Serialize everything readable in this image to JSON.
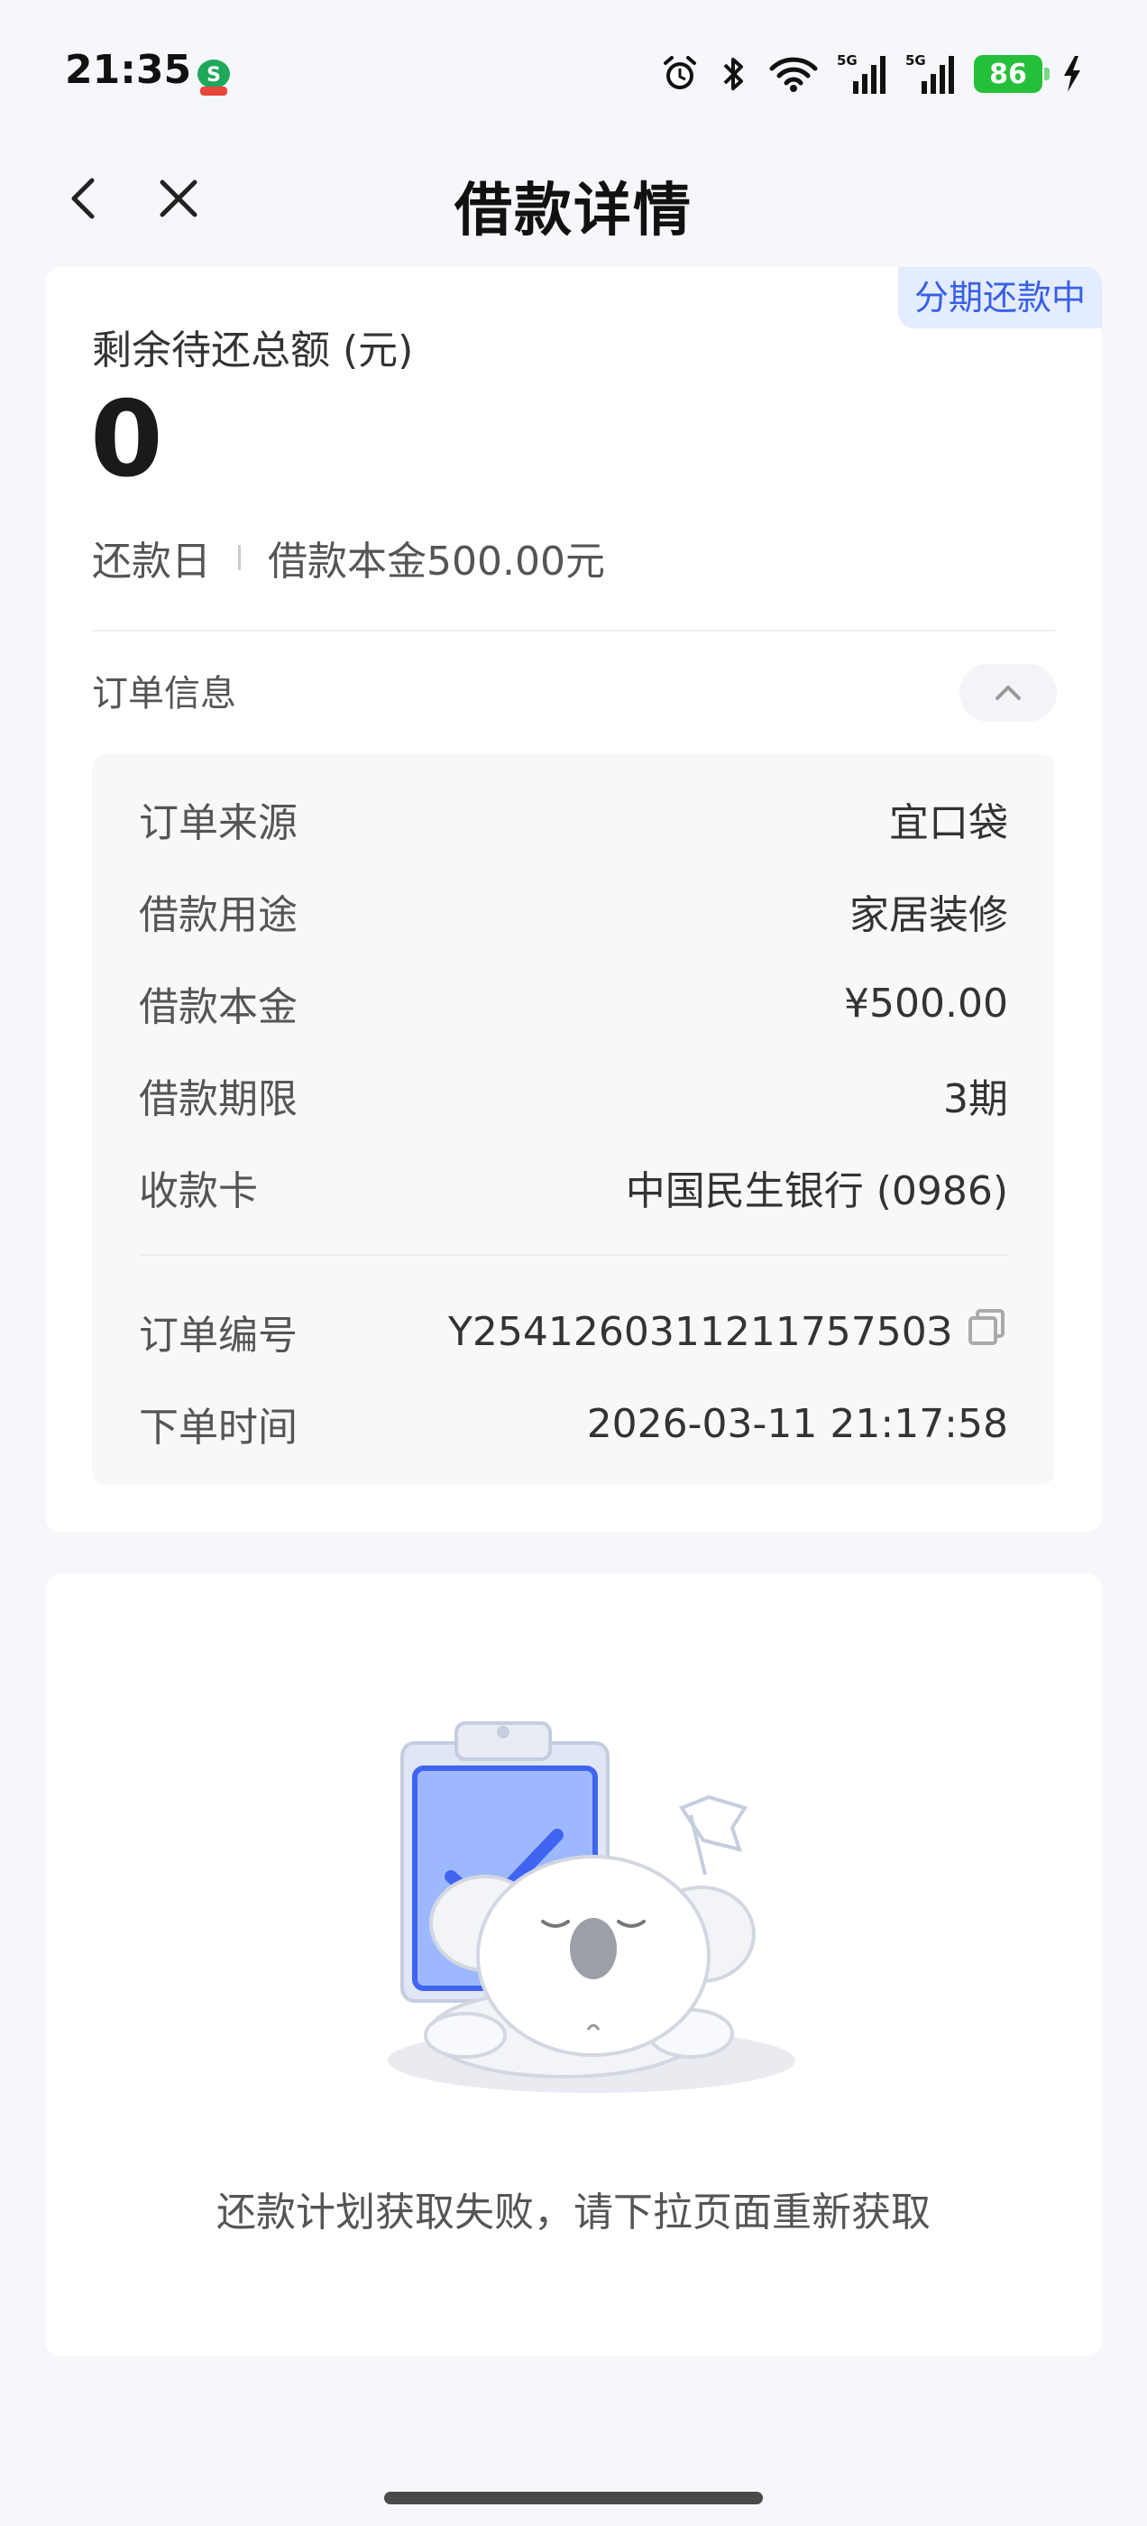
{
  "status_bar": {
    "time": "21:35",
    "battery": "86",
    "icons": [
      "app-s-icon",
      "alarm-icon",
      "bluetooth-icon",
      "wifi-icon",
      "signal-5g-icon",
      "signal-5g-icon",
      "battery-icon",
      "charging-icon"
    ]
  },
  "header": {
    "title": "借款详情",
    "back_icon": "chevron-left-icon",
    "close_icon": "close-icon"
  },
  "summary": {
    "status_badge": "分期还款中",
    "remaining_label": "剩余待还总额 (元)",
    "remaining_amount": "0",
    "repay_day_label": "还款日",
    "principal_text": "借款本金500.00元"
  },
  "order_info": {
    "section_title": "订单信息",
    "collapse_icon": "chevron-up-icon",
    "rows": [
      {
        "label": "订单来源",
        "value": "宜口袋"
      },
      {
        "label": "借款用途",
        "value": "家居装修"
      },
      {
        "label": "借款本金",
        "value": "¥500.00"
      },
      {
        "label": "借款期限",
        "value": "3期"
      },
      {
        "label": "收款卡",
        "value": "中国民生银行 (0986)"
      }
    ],
    "rows2": [
      {
        "label": "订单编号",
        "value": "Y254126031121175750З"
      },
      {
        "label": "下单时间",
        "value": "2026-03-11 21:17:58"
      }
    ],
    "copy_icon": "copy-icon"
  },
  "plan": {
    "illustration": "koala-clipboard-illustration",
    "error_text": "还款计划获取失败，请下拉页面重新获取"
  },
  "colors": {
    "accent": "#3860e8",
    "badge_bg": "#e4ecff",
    "battery": "#25c03a",
    "page_bg": "#f6f7fb"
  }
}
